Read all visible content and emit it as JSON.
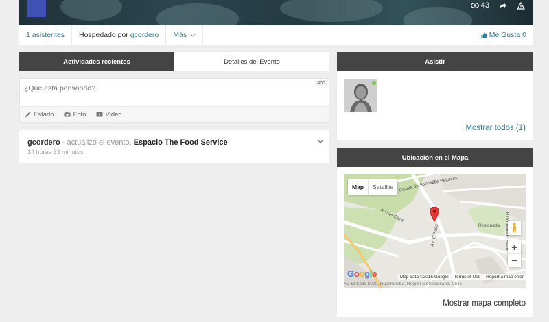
{
  "cover": {
    "views": "43"
  },
  "subnav": {
    "attendees": "1 asistentes",
    "hosted_prefix": "Hospedado por",
    "host": "gcordero",
    "more": "Más",
    "like": "Me Gusta 0"
  },
  "tabs": [
    {
      "label": "Actividades recientes",
      "active": true
    },
    {
      "label": "Detalles del Evento",
      "active": false
    }
  ],
  "composer": {
    "placeholder": "¿Que está pensando?",
    "counter": "400",
    "options": [
      {
        "label": "Estado",
        "icon": "pencil-icon"
      },
      {
        "label": "Foto",
        "icon": "camera-icon"
      },
      {
        "label": "Video",
        "icon": "video-icon"
      }
    ]
  },
  "activity": {
    "user": "gcordero",
    "verb": " - actualizó el evento, ",
    "object": "Espacio The Food Service",
    "time": "14 horas 33 minutos"
  },
  "attend": {
    "title": "Asistir",
    "show_all": "Mostrar todos (1)"
  },
  "map": {
    "title": "Ubicación en el Mapa",
    "type_map": "Map",
    "type_satellite": "Satellite",
    "zoom_in": "+",
    "zoom_out": "−",
    "google": "Google",
    "attribution": [
      "Map data ©2016 Google",
      "Terms of Use",
      "Report a map error"
    ],
    "address": "Av. El Salto 5000, Huechuraba, Región Metropolitana, Chile",
    "streets": [
      "Av Sta Clara",
      "Av. El Salto",
      "Rinconada El Salto",
      "Pasaje de Santiago",
      "Las Petunias",
      "Rinconada"
    ],
    "show_full": "Mostrar mapa completo"
  },
  "colors": {
    "accent_link": "#2f7c9a",
    "header_dark": "#444444",
    "thumb": "#3f51b5",
    "online": "#7cc242",
    "pin": "#e53935"
  }
}
